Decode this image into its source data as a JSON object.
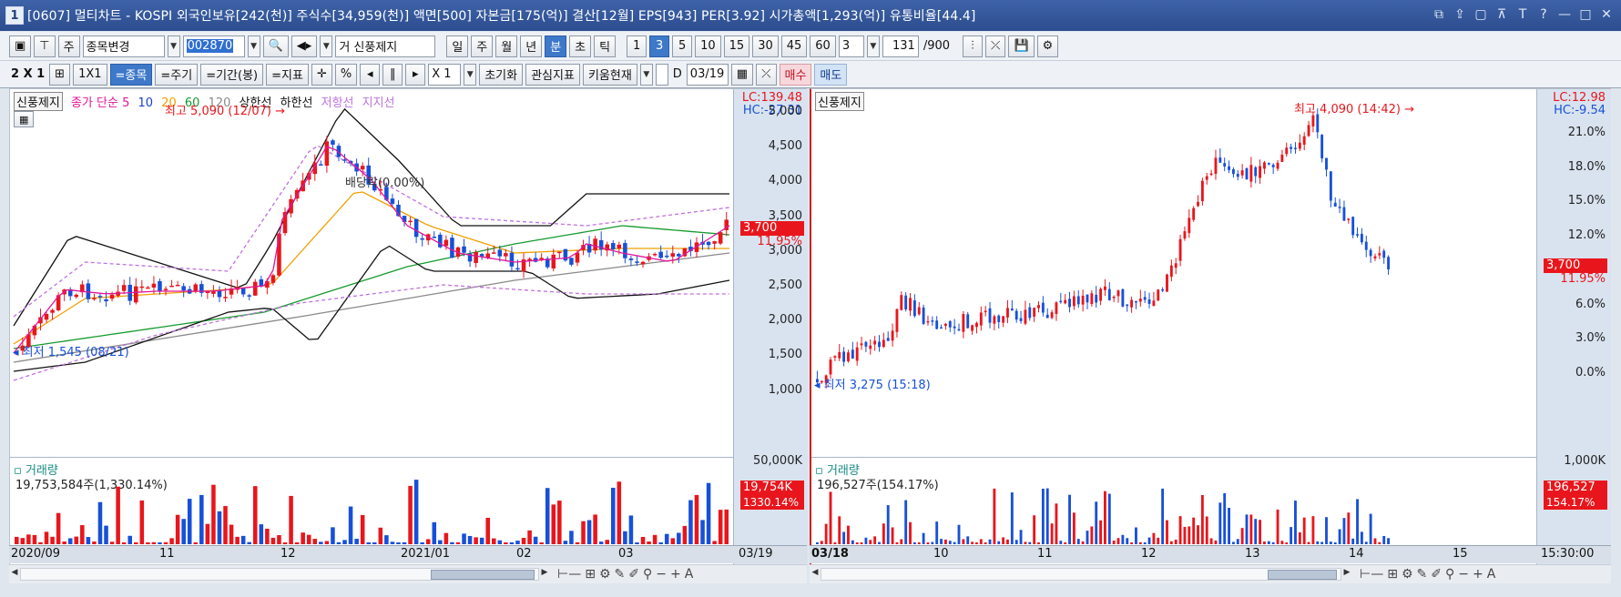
{
  "window": {
    "number": "1",
    "title": "[0607] 멀티차트 - KOSPI 외국인보유[242(천)] 주식수[34,959(천)] 액면[500] 자본금[175(억)] 결산[12월] EPS[943] PER[3.92] 시가총액[1,293(억)] 유통비율[44.4]",
    "controls": [
      "⧉",
      "⇪",
      "▢",
      "⊼",
      "T",
      "?",
      "—",
      "□",
      "✕"
    ]
  },
  "toolbar1": {
    "type_label": "주",
    "change_label": "종목변경",
    "code_value": "002870",
    "stock_name": "거 신풍제지",
    "periods": [
      "일",
      "주",
      "월",
      "년",
      "분",
      "초",
      "틱"
    ],
    "active_period": "분",
    "minutes": [
      "1",
      "3",
      "5",
      "10",
      "15",
      "30",
      "45",
      "60"
    ],
    "active_minute": "3",
    "count_select": "3",
    "bars_value": "131",
    "bars_total": "/900"
  },
  "toolbar2": {
    "layout": "2 X 1",
    "one_by_one": "1X1",
    "btn_same_stock": "=종목",
    "btn_same_cycle": "=주기",
    "btn_same_period": "=기간(봉)",
    "btn_same_indicator": "=지표",
    "percent": "%",
    "multiplier": "X 1",
    "reset": "초기화",
    "interest_indicator": "관심지표",
    "kiwoom": "키움현재",
    "d_label": "D",
    "date_value": "03/19",
    "buy": "매수",
    "sell": "매도"
  },
  "left": {
    "stock_label": "신풍제지",
    "legend": [
      {
        "text": "종가 단순 5",
        "color": "#e0169a"
      },
      {
        "text": "10",
        "color": "#1a3ed6"
      },
      {
        "text": "20",
        "color": "#f0a000"
      },
      {
        "text": "60",
        "color": "#169a2e"
      },
      {
        "text": "120",
        "color": "#8a8a8a"
      },
      {
        "text": "상한선",
        "color": "#111111"
      },
      {
        "text": "하한선",
        "color": "#111111"
      },
      {
        "text": "저항선",
        "color": "#c070e0"
      },
      {
        "text": "지지선",
        "color": "#c070e0"
      }
    ],
    "lc": "LC:139.48",
    "hc": "HC:-27.31",
    "y_labels": [
      "5,000",
      "4,500",
      "4,000",
      "3,500",
      "3,000",
      "2,500",
      "2,000",
      "1,500",
      "1,000"
    ],
    "price_tag": "3,700",
    "pct_tag": "11.95%",
    "high_note": "최고 5,090 (12/07)",
    "low_note": "최저 1,545 (08/21)",
    "dividend_note": "배당락(0.00%)",
    "volume_title": "거래량",
    "volume_value": "19,753,584주(1,330.14%)",
    "volume_axis": "50,000K",
    "volume_tag": "19,754K",
    "volume_pct_tag": "1330.14%",
    "x_labels": [
      "2020/09",
      "11",
      "12",
      "2021/01",
      "02",
      "03",
      "03/19"
    ]
  },
  "right": {
    "stock_label": "신풍제지",
    "lc": "LC:12.98",
    "hc": "HC:-9.54",
    "y_labels": [
      "21.0%",
      "18.0%",
      "15.0%",
      "12.0%",
      "9.0%",
      "6.0%",
      "3.0%",
      "0.0%"
    ],
    "price_tag": "3,700",
    "pct_tag": "11.95%",
    "high_note": "최고 4,090 (14:42)",
    "low_note": "최저 3,275 (15:18)",
    "volume_title": "거래량",
    "volume_value": "196,527주(154.17%)",
    "volume_axis": "1,000K",
    "volume_tag": "196,527",
    "volume_pct_tag": "154.17%",
    "x_labels": [
      "03/18",
      "10",
      "11",
      "12",
      "13",
      "14",
      "15",
      "15:30:00"
    ]
  },
  "colors": {
    "up": "#e8161c",
    "down": "#1750d8",
    "accent": "#3e78c9",
    "axis_bg": "#d9e3ef"
  }
}
